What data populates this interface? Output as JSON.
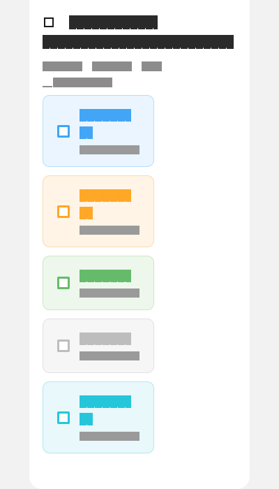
{
  "header": {
    "title_line1": "██████████",
    "title_line2": "█████████████████████",
    "meta_a": "█████",
    "meta_b": "█████",
    "meta_c": "██",
    "meta_d": "████████"
  },
  "options": [
    {
      "label_line1": "██████",
      "label_line2": "█",
      "description": "████████",
      "accent": "#42a5f5",
      "background": "#eaf5ff",
      "border": "#b9ddf7"
    },
    {
      "label_line1": "██████",
      "label_line2": "█",
      "description": "████████",
      "accent": "#ffa726",
      "background": "#fff4e6",
      "border": "#f8dbb2"
    },
    {
      "label_line1": "██████",
      "label_line2": "",
      "description": "███████",
      "accent": "#66bb6a",
      "background": "#eef7ec",
      "border": "#cde6c9"
    },
    {
      "label_line1": "██████",
      "label_line2": "",
      "description": "████████",
      "accent": "#bdbdbd",
      "background": "#f6f6f6",
      "border": "#e1e1e1"
    },
    {
      "label_line1": "██████",
      "label_line2": "█",
      "description": "████████",
      "accent": "#26c6da",
      "background": "#e8f8fb",
      "border": "#b5e7ef"
    }
  ]
}
